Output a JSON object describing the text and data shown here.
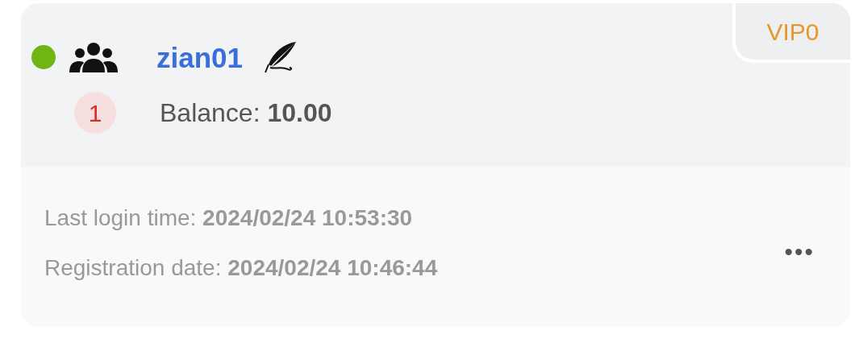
{
  "user": {
    "online": true,
    "username": "zian01",
    "vip_level": "VIP0",
    "badge_count": "1",
    "balance": "Balance: **10.00**"
  },
  "details": {
    "last_login": "Last login time: **2024/02/24 10:53:30**",
    "registration": "Registration date: **2024/02/24 10:46:44**",
    "more": "•••"
  }
}
